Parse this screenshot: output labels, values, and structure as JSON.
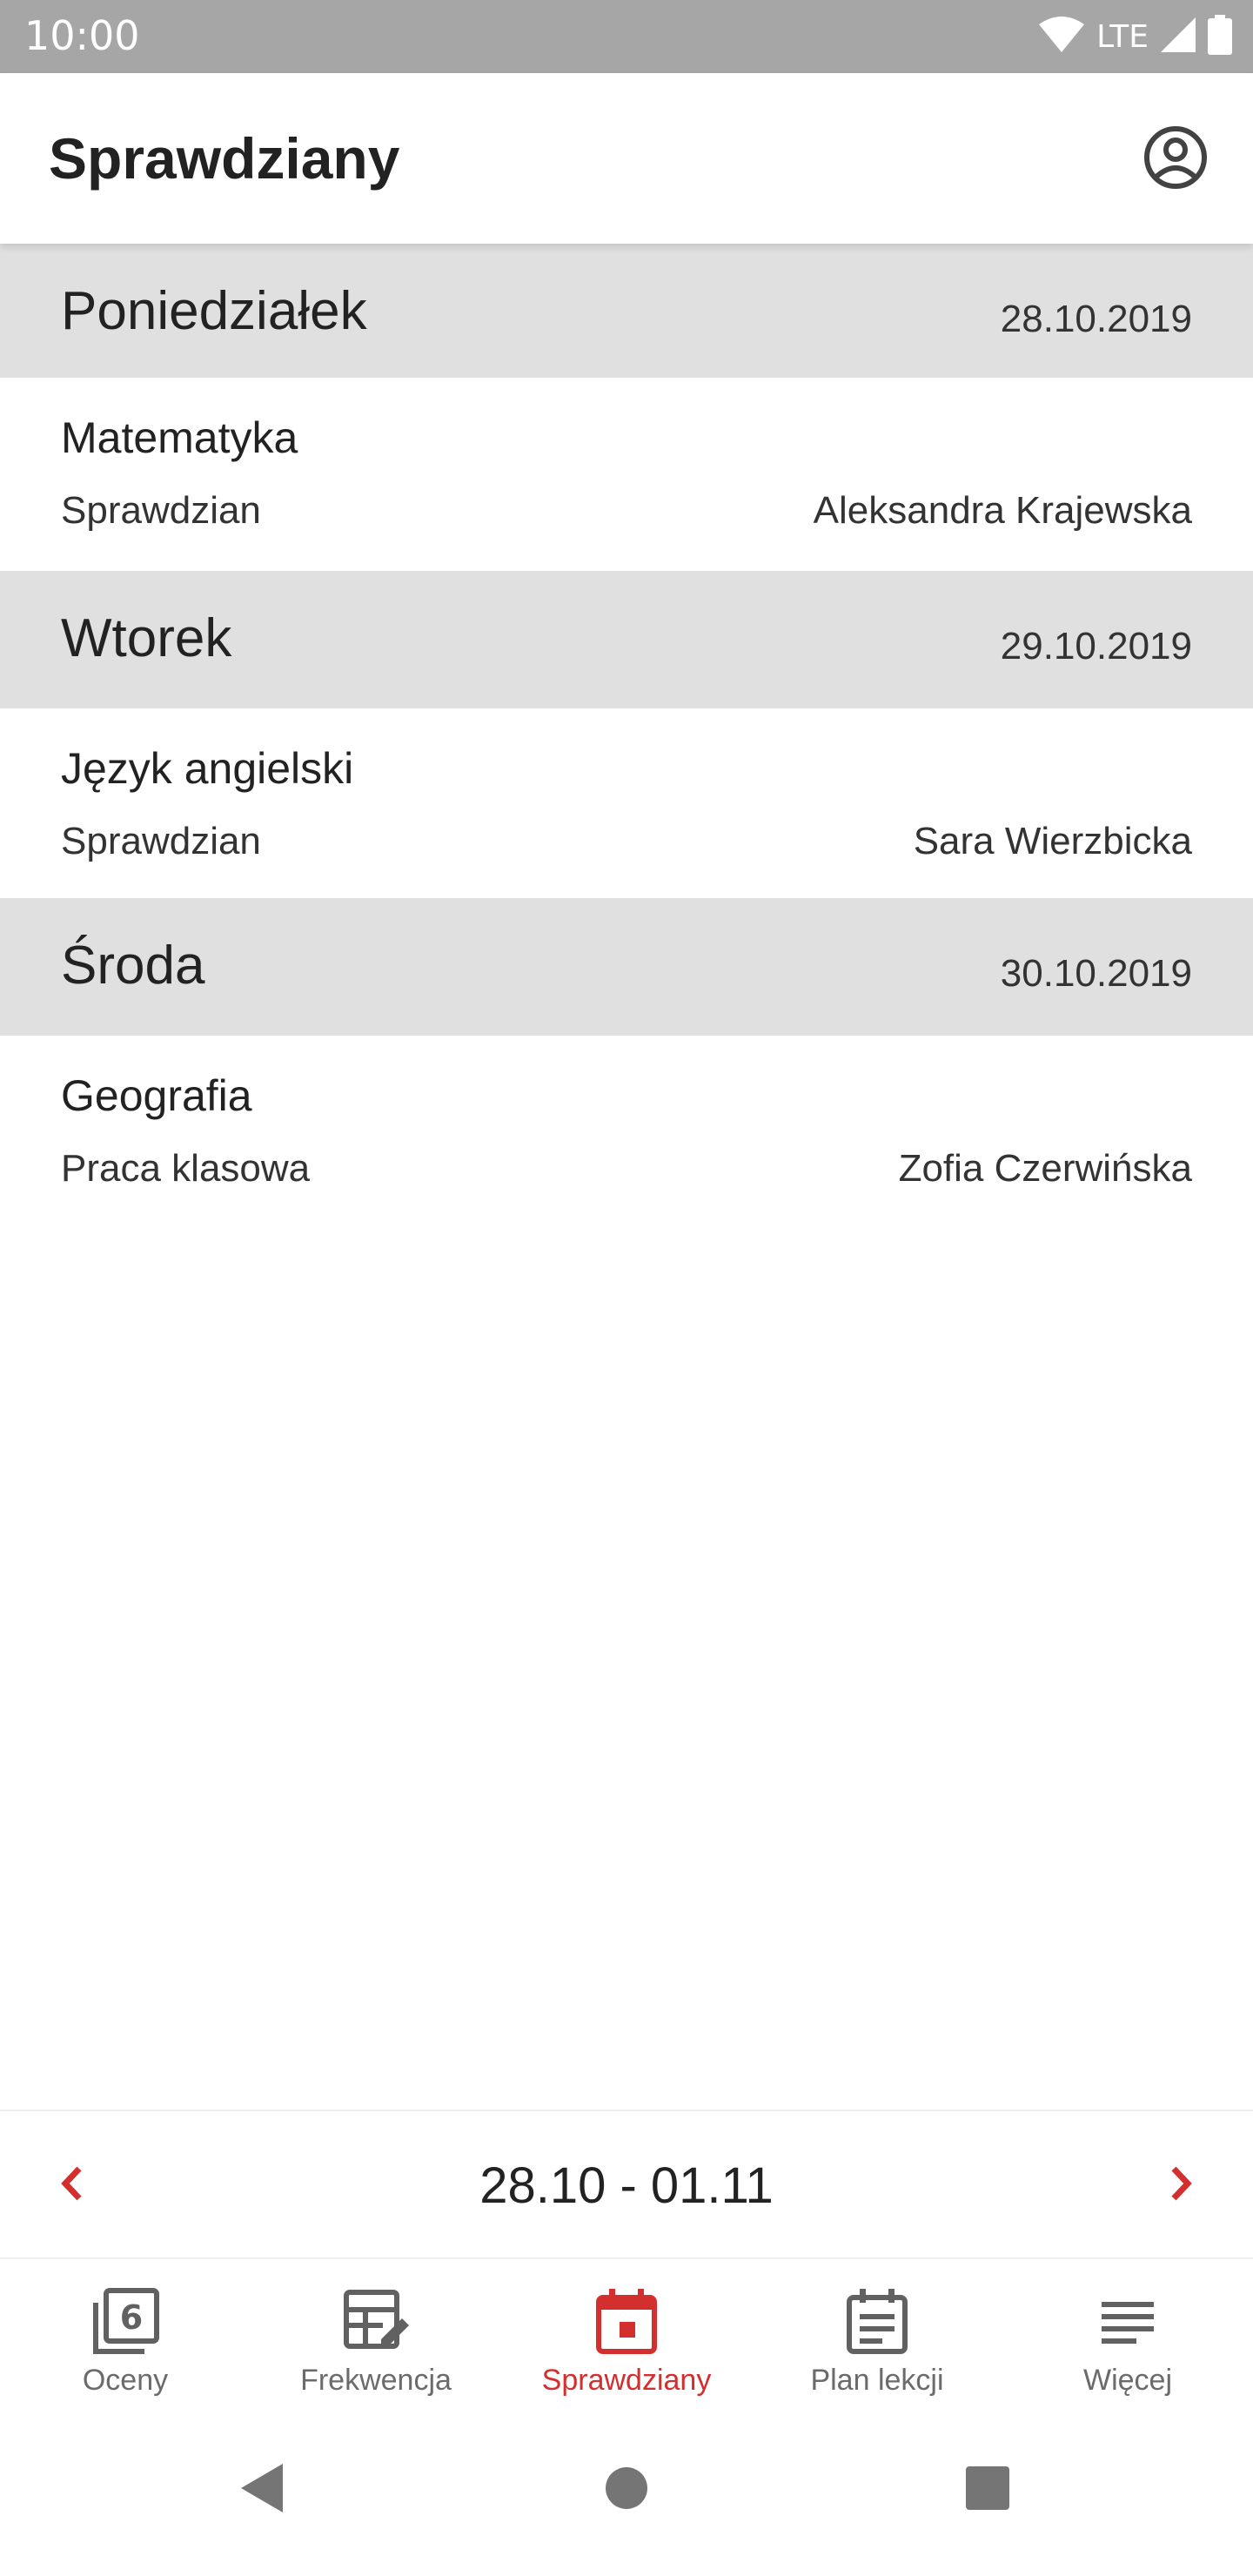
{
  "status_bar": {
    "time": "10:00",
    "network": "LTE"
  },
  "app_bar": {
    "title": "Sprawdziany",
    "account_icon": "account-circle-icon"
  },
  "days": [
    {
      "name": "Poniedziałek",
      "date": "28.10.2019",
      "exams": [
        {
          "subject": "Matematyka",
          "type": "Sprawdzian",
          "teacher": "Aleksandra Krajewska"
        }
      ]
    },
    {
      "name": "Wtorek",
      "date": "29.10.2019",
      "exams": [
        {
          "subject": "Język angielski",
          "type": "Sprawdzian",
          "teacher": "Sara Wierzbicka"
        }
      ]
    },
    {
      "name": "Środa",
      "date": "30.10.2019",
      "exams": [
        {
          "subject": "Geografia",
          "type": "Praca klasowa",
          "teacher": "Zofia Czerwińska"
        }
      ]
    }
  ],
  "week_nav": {
    "range": "28.10 - 01.11",
    "prev_icon": "chevron-left-icon",
    "next_icon": "chevron-right-icon"
  },
  "bottom_nav": {
    "items": [
      {
        "label": "Oceny",
        "icon": "grade-six-icon",
        "active": false
      },
      {
        "label": "Frekwencja",
        "icon": "attendance-table-icon",
        "active": false
      },
      {
        "label": "Sprawdziany",
        "icon": "calendar-event-icon",
        "active": true
      },
      {
        "label": "Plan lekcji",
        "icon": "timetable-icon",
        "active": false
      },
      {
        "label": "Więcej",
        "icon": "menu-lines-icon",
        "active": false
      }
    ]
  },
  "colors": {
    "accent": "#d32f2f",
    "day_header_bg": "#e0e0e0",
    "status_bar_bg": "#a6a6a6",
    "inactive_icon": "#616161"
  }
}
